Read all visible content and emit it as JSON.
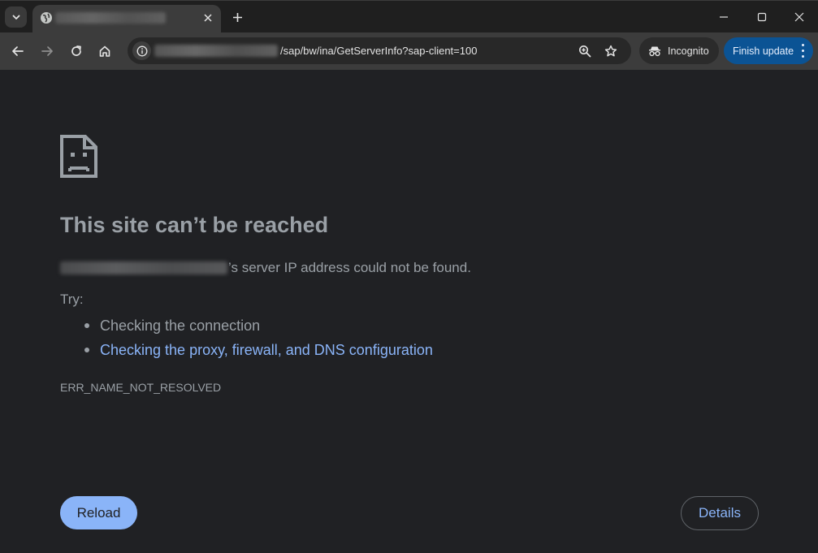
{
  "browser": {
    "tab": {
      "icon": "globe-icon",
      "close_icon": "close-icon"
    },
    "address_bar": {
      "path": "/sap/bw/ina/GetServerInfo?sap-client=100"
    },
    "incognito_label": "Incognito",
    "update_button_label": "Finish update"
  },
  "error_page": {
    "icon": "sad-file-icon",
    "heading": "This site can’t be reached",
    "host_suffix": "’s server IP address could not be found.",
    "try_label": "Try:",
    "suggestions": [
      {
        "text": "Checking the connection"
      },
      {
        "text": "Checking the proxy, firewall, and DNS configuration"
      }
    ],
    "error_code": "ERR_NAME_NOT_RESOLVED",
    "reload_label": "Reload",
    "details_label": "Details"
  },
  "colors": {
    "background": "#202124",
    "text_secondary": "#9aa0a6",
    "link": "#8ab4f8",
    "primary_button": "#8ab4f8",
    "update_button": "#0b5394"
  }
}
